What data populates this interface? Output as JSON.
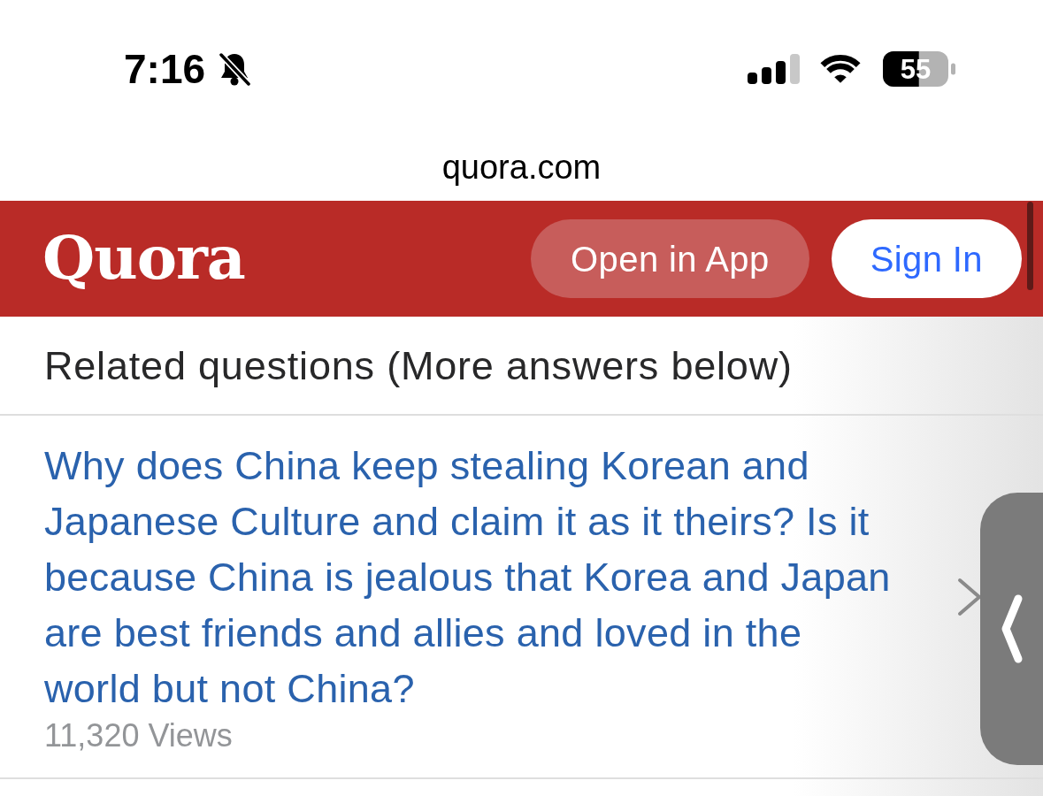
{
  "status_bar": {
    "time": "7:16",
    "battery": "55"
  },
  "address_bar": {
    "url": "quora.com"
  },
  "header": {
    "logo": "Quora",
    "buttons": [
      {
        "label": "Open in App",
        "kind": "secondary"
      },
      {
        "label": "Sign In",
        "kind": "primary"
      }
    ]
  },
  "related": {
    "title": "Related questions (More answers below)",
    "questions": [
      {
        "text": "Why does China keep stealing Korean and Japanese Culture and claim it as it theirs? Is it because China is jealous that Korea and Japan are best friends and allies and loved in the world but not China?",
        "views": "11,320 Views"
      }
    ]
  }
}
